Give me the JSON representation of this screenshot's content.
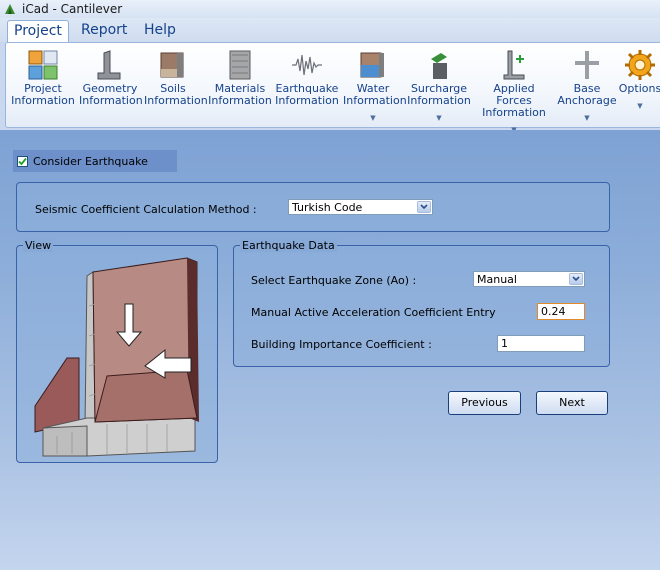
{
  "app": {
    "title": "iCad - Cantilever"
  },
  "menu_tabs": [
    {
      "label": "Project"
    },
    {
      "label": "Report"
    },
    {
      "label": "Help"
    }
  ],
  "ribbon": {
    "items": [
      {
        "line1": "Project",
        "line2": "Information",
        "icon": "project-information-icon"
      },
      {
        "line1": "Geometry",
        "line2": "Information",
        "icon": "geometry-icon"
      },
      {
        "line1": "Soils",
        "line2": "Information",
        "icon": "soils-icon"
      },
      {
        "line1": "Materials",
        "line2": "Information",
        "icon": "materials-icon"
      },
      {
        "line1": "Earthquake",
        "line2": "Information",
        "icon": "earthquake-icon"
      },
      {
        "line1": "Water",
        "line2": "Information",
        "icon": "water-icon"
      },
      {
        "line1": "Surcharge",
        "line2": "Information",
        "icon": "surcharge-icon"
      },
      {
        "line1": "Applied Forces",
        "line2": "Information",
        "icon": "applied-forces-icon"
      },
      {
        "line1": "Base",
        "line2": "Anchorage",
        "icon": "base-anchorage-icon"
      },
      {
        "line1": "Options",
        "line2": "",
        "icon": "options-gear-icon"
      }
    ]
  },
  "consider_earthquake": {
    "label": "Consider Earthquake",
    "checked": true
  },
  "seismic": {
    "label": "Seismic Coefficient Calculation Method  :",
    "selected": "Turkish Code"
  },
  "view_panel": {
    "title": "View"
  },
  "earthquake_data": {
    "title": "Earthquake Data",
    "zone_label": "Select Earthquake Zone (Ao) :",
    "zone_selected": "Manual",
    "acc_label": "Manual Active Acceleration Coefficient Entry",
    "acc_value": "0.24",
    "importance_label": "Building Importance Coefficient :",
    "importance_value": "1"
  },
  "buttons": {
    "previous": "Previous",
    "next": "Next"
  },
  "colors": {
    "accent": "#15428b",
    "panel_border": "#3a62a8",
    "active_input_border": "#e08a2c"
  }
}
